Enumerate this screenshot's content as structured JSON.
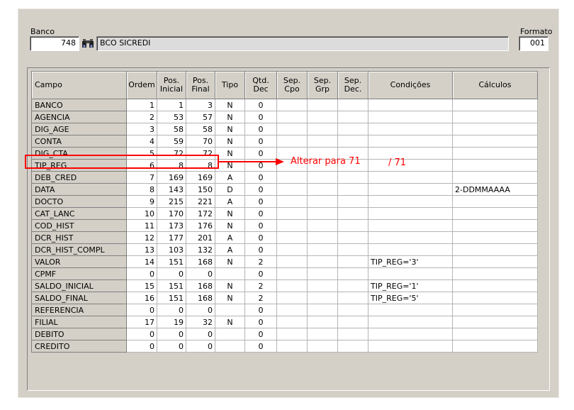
{
  "header": {
    "banco_label": "Banco",
    "banco_code": "748",
    "banco_name": "BCO SICREDI",
    "formato_label": "Formato",
    "formato_value": "001"
  },
  "columns": [
    {
      "key": "campo",
      "label1": "Campo",
      "label2": ""
    },
    {
      "key": "ordem",
      "label1": "Ordem",
      "label2": ""
    },
    {
      "key": "pos_ini",
      "label1": "Pos.",
      "label2": "Inicial"
    },
    {
      "key": "pos_fin",
      "label1": "Pos.",
      "label2": "Final"
    },
    {
      "key": "tipo",
      "label1": "Tipo",
      "label2": ""
    },
    {
      "key": "qtd_dec",
      "label1": "Qtd.",
      "label2": "Dec"
    },
    {
      "key": "sep_cpo",
      "label1": "Sep.",
      "label2": "Cpo"
    },
    {
      "key": "sep_grp",
      "label1": "Sep.",
      "label2": "Grp"
    },
    {
      "key": "sep_dec",
      "label1": "Sep.",
      "label2": "Dec."
    },
    {
      "key": "condicoes",
      "label1": "Condições",
      "label2": ""
    },
    {
      "key": "calculos",
      "label1": "Cálculos",
      "label2": ""
    }
  ],
  "rows": [
    [
      "BANCO",
      "1",
      "1",
      "3",
      "N",
      "0",
      "",
      "",
      "",
      "",
      ""
    ],
    [
      "AGENCIA",
      "2",
      "53",
      "57",
      "N",
      "0",
      "",
      "",
      "",
      "",
      ""
    ],
    [
      "DIG_AGE",
      "3",
      "58",
      "58",
      "N",
      "0",
      "",
      "",
      "",
      "",
      ""
    ],
    [
      "CONTA",
      "4",
      "59",
      "70",
      "N",
      "0",
      "",
      "",
      "",
      "",
      ""
    ],
    [
      "DIG_CTA",
      "5",
      "72",
      "72",
      "N",
      "0",
      "",
      "",
      "",
      "",
      ""
    ],
    [
      "TIP_REG",
      "6",
      "8",
      "8",
      "N",
      "0",
      "",
      "",
      "",
      "",
      ""
    ],
    [
      "DEB_CRED",
      "7",
      "169",
      "169",
      "A",
      "0",
      "",
      "",
      "",
      "",
      ""
    ],
    [
      "DATA",
      "8",
      "143",
      "150",
      "D",
      "0",
      "",
      "",
      "",
      "",
      "2-DDMMAAAA"
    ],
    [
      "DOCTO",
      "9",
      "215",
      "221",
      "A",
      "0",
      "",
      "",
      "",
      "",
      ""
    ],
    [
      "CAT_LANC",
      "10",
      "170",
      "172",
      "N",
      "0",
      "",
      "",
      "",
      "",
      ""
    ],
    [
      "COD_HIST",
      "11",
      "173",
      "176",
      "N",
      "0",
      "",
      "",
      "",
      "",
      ""
    ],
    [
      "DCR_HIST",
      "12",
      "177",
      "201",
      "A",
      "0",
      "",
      "",
      "",
      "",
      ""
    ],
    [
      "DCR_HIST_COMPL",
      "13",
      "103",
      "132",
      "A",
      "0",
      "",
      "",
      "",
      "",
      ""
    ],
    [
      "VALOR",
      "14",
      "151",
      "168",
      "N",
      "2",
      "",
      "",
      "",
      "TIP_REG='3'",
      ""
    ],
    [
      "CPMF",
      "0",
      "0",
      "0",
      "",
      "0",
      "",
      "",
      "",
      "",
      ""
    ],
    [
      "SALDO_INICIAL",
      "15",
      "151",
      "168",
      "N",
      "2",
      "",
      "",
      "",
      "TIP_REG='1'",
      ""
    ],
    [
      "SALDO_FINAL",
      "16",
      "151",
      "168",
      "N",
      "2",
      "",
      "",
      "",
      "TIP_REG='5'",
      ""
    ],
    [
      "REFERENCIA",
      "0",
      "0",
      "0",
      "",
      "0",
      "",
      "",
      "",
      "",
      ""
    ],
    [
      "FILIAL",
      "17",
      "19",
      "32",
      "N",
      "0",
      "",
      "",
      "",
      "",
      ""
    ],
    [
      "DEBITO",
      "0",
      "0",
      "0",
      "",
      "0",
      "",
      "",
      "",
      "",
      ""
    ],
    [
      "CREDITO",
      "0",
      "0",
      "0",
      "",
      "0",
      "",
      "",
      "",
      "",
      ""
    ]
  ],
  "annotation": {
    "text1": "Alterar para 71",
    "text2": "/  71",
    "color": "#ff0000"
  }
}
